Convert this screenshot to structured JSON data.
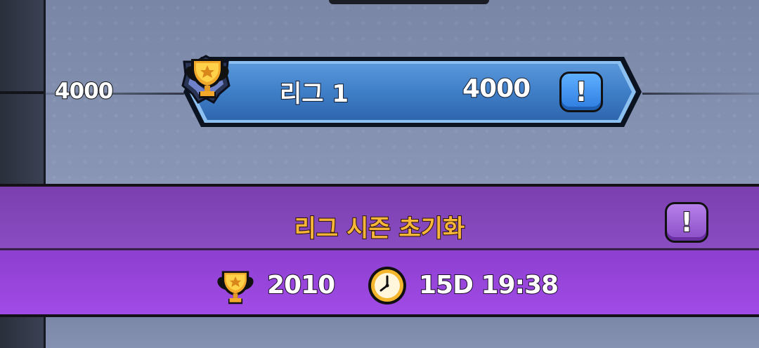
{
  "tier": {
    "threshold_label": "4000"
  },
  "league": {
    "name": "리그 1",
    "rank_numeral": "I",
    "trophy_value": "4000",
    "info_label": "!",
    "icons": {
      "rank": "league-rank-badge-icon",
      "trophy": "trophy-icon"
    },
    "colors": {
      "banner": "#3f7fc8",
      "banner_border": "#0f1a2e"
    }
  },
  "season": {
    "title": "리그 시즌 초기화",
    "info_label": "!",
    "trophy_count": "2010",
    "time_remaining": "15D 19:38",
    "icons": {
      "trophy": "trophy-icon",
      "timer": "clock-icon"
    },
    "colors": {
      "bar": "#8f45d4",
      "title_text": "#f7b63a"
    }
  }
}
